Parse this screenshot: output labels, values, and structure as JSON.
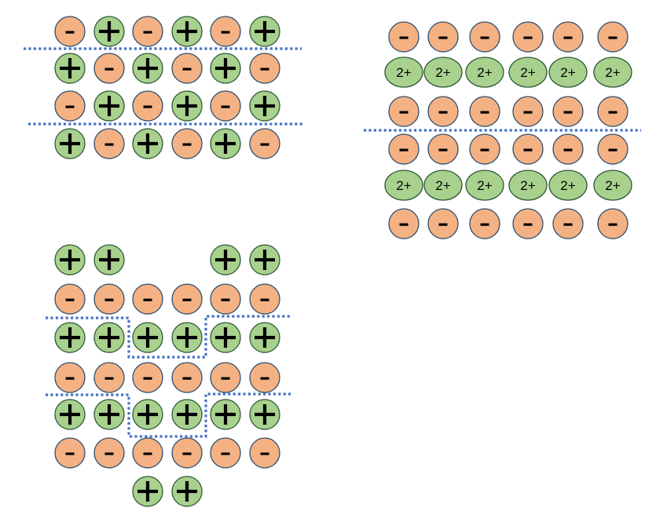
{
  "colors": {
    "positive_fill": "#a9d18e",
    "positive_stroke": "#2f5a38",
    "negative_fill": "#f4b183",
    "negative_stroke": "#2f4f6f",
    "cut_line": "#4472c4"
  },
  "labels": {
    "plus": "+",
    "minus": "-",
    "dication": "2+"
  },
  "panels": {
    "top_left": {
      "rows": [
        [
          "-",
          "+",
          "-",
          "+",
          "-",
          "+"
        ],
        [
          "+",
          "-",
          "+",
          "-",
          "+",
          "-"
        ],
        [
          "-",
          "+",
          "-",
          "+",
          "-",
          "+"
        ],
        [
          "+",
          "-",
          "+",
          "-",
          "+",
          "-"
        ]
      ]
    },
    "top_right": {
      "rows": [
        [
          "-",
          "-",
          "-",
          "-",
          "-",
          "-"
        ],
        [
          "2+",
          "2+",
          "2+",
          "2+",
          "2+",
          "2+"
        ],
        [
          "-",
          "-",
          "-",
          "-",
          "-",
          "-"
        ],
        [
          "-",
          "-",
          "-",
          "-",
          "-",
          "-"
        ],
        [
          "2+",
          "2+",
          "2+",
          "2+",
          "2+",
          "2+"
        ],
        [
          "-",
          "-",
          "-",
          "-",
          "-",
          "-"
        ]
      ]
    },
    "bottom_left": {
      "rows": [
        [
          "+",
          "+",
          "",
          "",
          "+",
          "+"
        ],
        [
          "-",
          "-",
          "-",
          "-",
          "-",
          "-"
        ],
        [
          "+",
          "+",
          "+",
          "+",
          "+",
          "+"
        ],
        [
          "-",
          "-",
          "-",
          "-",
          "-",
          "-"
        ],
        [
          "+",
          "+",
          "+",
          "+",
          "+",
          "+"
        ],
        [
          "-",
          "-",
          "-",
          "-",
          "-",
          "-"
        ],
        [
          "",
          "",
          "+",
          "+",
          "",
          ""
        ]
      ]
    }
  }
}
